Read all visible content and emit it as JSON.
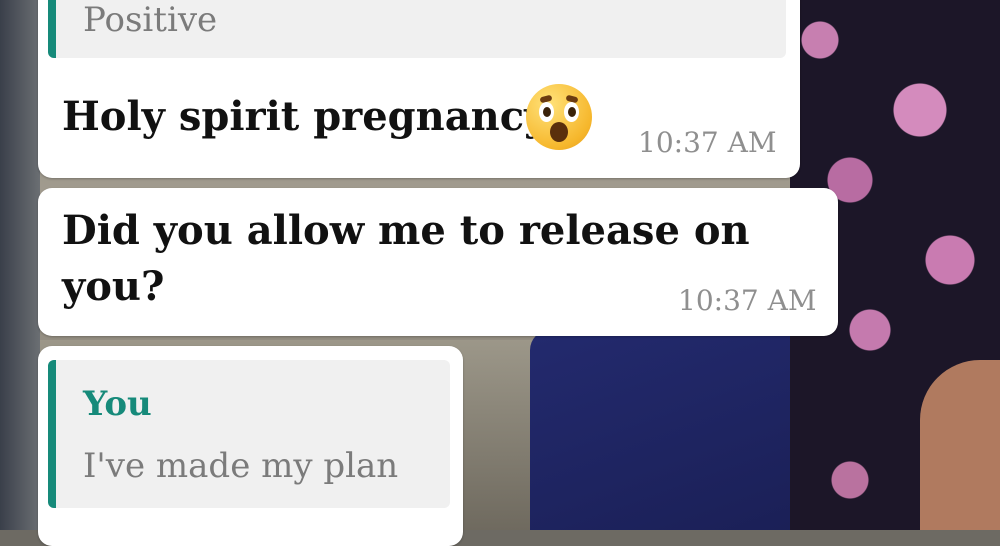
{
  "messages": [
    {
      "quoted_text": "Positive",
      "text": "Holy spirit pregnancy",
      "emoji": "astonished-face",
      "time": "10:37 AM"
    },
    {
      "text_line1": "Did you allow me to release on",
      "text_line2": "you?",
      "time": "10:37 AM"
    },
    {
      "quoted_sender": "You",
      "quoted_text": "I've made my plan"
    }
  ],
  "colors": {
    "bubble": "#ffffff",
    "quote_bar": "#168a7a",
    "quote_bg": "#f0f0f0",
    "time": "#8f8f8f"
  }
}
